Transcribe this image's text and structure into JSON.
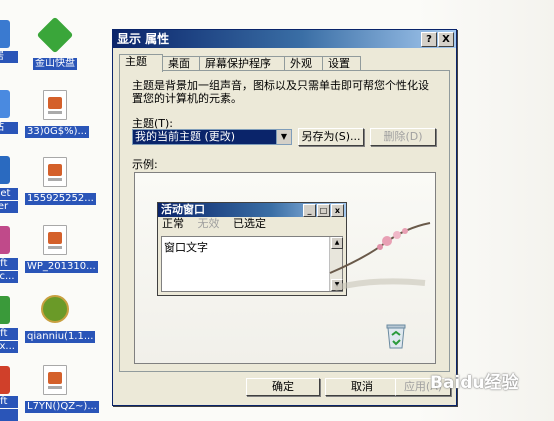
{
  "desktop": {
    "icons": [
      {
        "label": "金山快盘"
      },
      {
        "label": "33)0G$%)..."
      },
      {
        "label": "155925252..."
      },
      {
        "label": "WP_201310..."
      },
      {
        "label": "qianniu(1.1..."
      },
      {
        "label": "L7YN()QZ~)..."
      }
    ],
    "edge_labels": [
      "居",
      "站",
      "het",
      "rer",
      "oft",
      "cc...",
      "oft",
      "cx...",
      "oft",
      "i"
    ]
  },
  "window": {
    "title": "显示 属性",
    "title_buttons": {
      "help": "?",
      "close": "X"
    },
    "tabs": [
      "主题",
      "桌面",
      "屏幕保护程序",
      "外观",
      "设置"
    ],
    "description": "主题是背景加一组声音，图标以及只需单击即可帮您个性化设置您的计算机的元素。",
    "theme_label": "主题(T):",
    "theme_value": "我的当前主题 (更改)",
    "save_as_button": "另存为(S)...",
    "delete_button": "删除(D)",
    "sample_label": "示例:",
    "preview": {
      "window_title": "活动窗口",
      "menu": [
        "正常",
        "无效",
        "已选定"
      ],
      "text": "窗口文字"
    },
    "buttons": {
      "ok": "确定",
      "cancel": "取消",
      "apply": "应用(A)"
    }
  },
  "watermark": "Baidu经验"
}
